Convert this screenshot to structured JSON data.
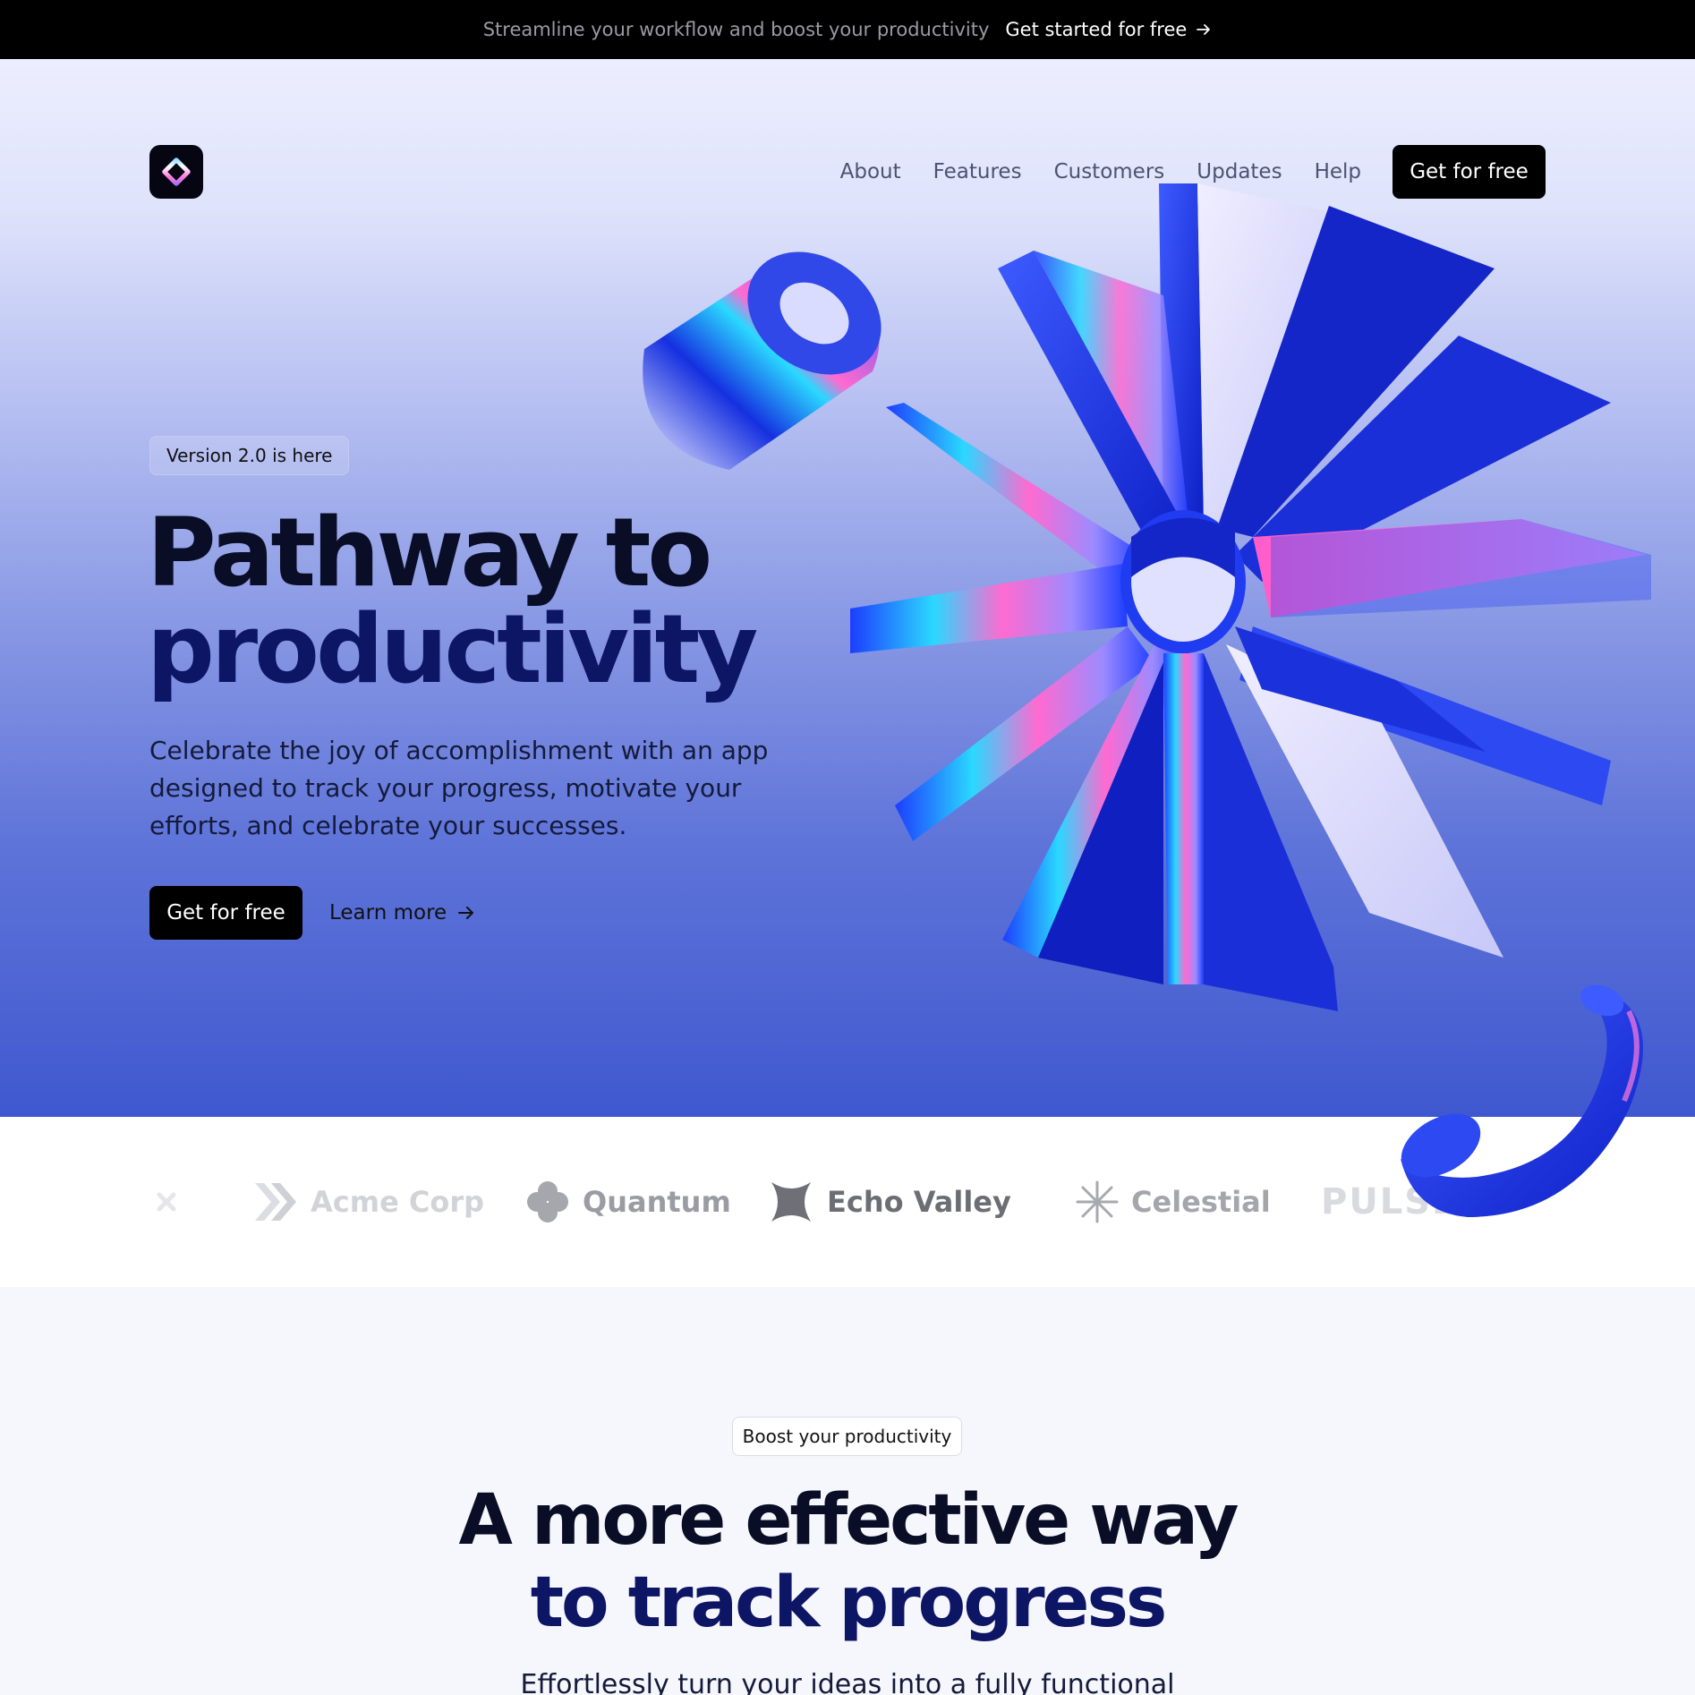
{
  "announcement": {
    "message": "Streamline your workflow and boost your productivity",
    "cta_label": "Get started for free",
    "cta_icon": "arrow-right-icon"
  },
  "nav": {
    "logo_icon": "diamond-logo-icon",
    "links": [
      "About",
      "Features",
      "Customers",
      "Updates",
      "Help"
    ],
    "cta_label": "Get for free"
  },
  "hero": {
    "badge": "Version 2.0 is here",
    "title_line1": "Pathway to",
    "title_line2": "productivity",
    "description": "Celebrate the joy of accomplishment with an app designed to track your progress, motivate your efforts, and celebrate your successes.",
    "primary_cta": "Get for free",
    "secondary_cta": "Learn more",
    "secondary_icon": "arrow-right-icon"
  },
  "logo_cloud": {
    "items": [
      {
        "name": "Acme Corp",
        "icon": "double-chevron-icon"
      },
      {
        "name": "Quantum",
        "icon": "clover-icon"
      },
      {
        "name": "Echo Valley",
        "icon": "x-mark-icon"
      },
      {
        "name": "Celestial",
        "icon": "asterisk-icon"
      },
      {
        "name": "PULSE",
        "icon": ""
      }
    ]
  },
  "features": {
    "badge": "Boost your productivity",
    "title_line1": "A more effective way",
    "title_line2": "to track progress",
    "subtitle": "Effortlessly turn your ideas into a fully functional"
  },
  "colors": {
    "accent_dark": "#0d1565",
    "announcement_bg": "#000000",
    "button_bg": "#000000",
    "hero_gradient_top": "#eceefe",
    "hero_gradient_bottom": "#3f58cf",
    "art_blue": "#1530e0"
  }
}
